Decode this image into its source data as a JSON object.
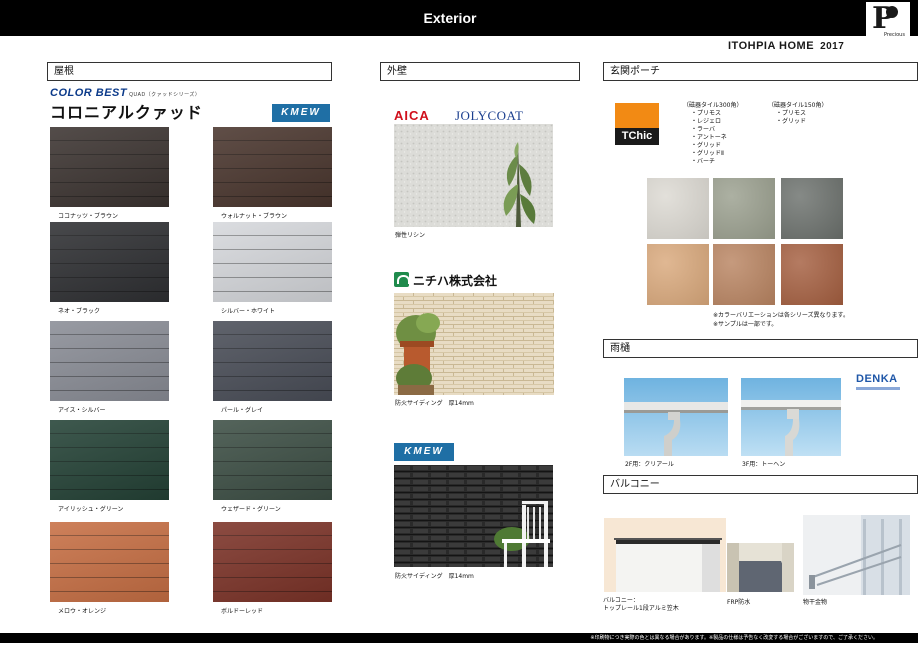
{
  "header": {
    "title": "Exterior"
  },
  "logo": {
    "mark": "P",
    "word": "Precious"
  },
  "brand": {
    "name": "ITOHPIA HOME",
    "year": "2017"
  },
  "sections": {
    "roof": "屋根",
    "wall": "外壁",
    "entrance": "玄関ポーチ",
    "gutter": "雨樋",
    "balcony": "バルコニー"
  },
  "roof": {
    "series_logo": "COLOR BEST",
    "series_sub": "QUAD（クァッドシリーズ）",
    "product": "コロニアルクァッド",
    "maker": "KMEW",
    "swatches": [
      {
        "label": "ココナッツ・ブラウン",
        "color": "#3c3431"
      },
      {
        "label": "ウォルナット・ブラウン",
        "color": "#4a362e"
      },
      {
        "label": "ネオ・ブラック",
        "color": "#2f3033"
      },
      {
        "label": "シルバー・ホワイト",
        "color": "#d6d8dc"
      },
      {
        "label": "アイス・シルバー",
        "color": "#8a8d96"
      },
      {
        "label": "パール・グレイ",
        "color": "#4a4e58"
      },
      {
        "label": "アイリッシュ・グリーン",
        "color": "#244236"
      },
      {
        "label": "ウェザード・グリーン",
        "color": "#3d4f45"
      },
      {
        "label": "メロウ・オレンジ",
        "color": "#c76f44"
      },
      {
        "label": "ボルドーレッド",
        "color": "#7c3328"
      }
    ]
  },
  "wall": {
    "aica": "AICA",
    "jolycoat": "JOLYCOAT",
    "item1": "弾性リシン",
    "nichiha": "ニチハ株式会社",
    "item2": "防火サイディング　厚14mm",
    "kmew": "KMEW",
    "item3": "防火サイディング　厚14mm"
  },
  "entrance": {
    "maker": "TChic",
    "list300_title": "（磁器タイル300角）",
    "list300": [
      "・プリモス",
      "・レジェロ",
      "・ラーバ",
      "・アントーネ",
      "・グリッド",
      "・グリッドⅡ",
      "・バーチ"
    ],
    "list150_title": "（磁器タイル150角）",
    "list150": [
      "・プリモス",
      "・グリッド"
    ],
    "tiles": [
      {
        "color": "#dcd9d2"
      },
      {
        "color": "#9a9f8e"
      },
      {
        "color": "#6b706c"
      },
      {
        "color": "#d9a87b"
      },
      {
        "color": "#b98461"
      },
      {
        "color": "#a45e3f"
      }
    ],
    "note1": "※カラーバリエーションは各シリーズ異なります。",
    "note2": "※サンプルは一部です。"
  },
  "gutter": {
    "maker": "DENKA",
    "item1": "2F用：クリアール",
    "item2": "3F用：トーヘン"
  },
  "balcony": {
    "item1_line1": "バルコニー：",
    "item1_line2": "トップレール1段アルミ笠木",
    "item2": "FRP防水",
    "item3": "物干金物"
  },
  "footer": {
    "note": "※印刷物につき実際の色とは異なる場合があります。※製品の仕様は予告なく改変する場合がございますので、ご了承ください。"
  }
}
